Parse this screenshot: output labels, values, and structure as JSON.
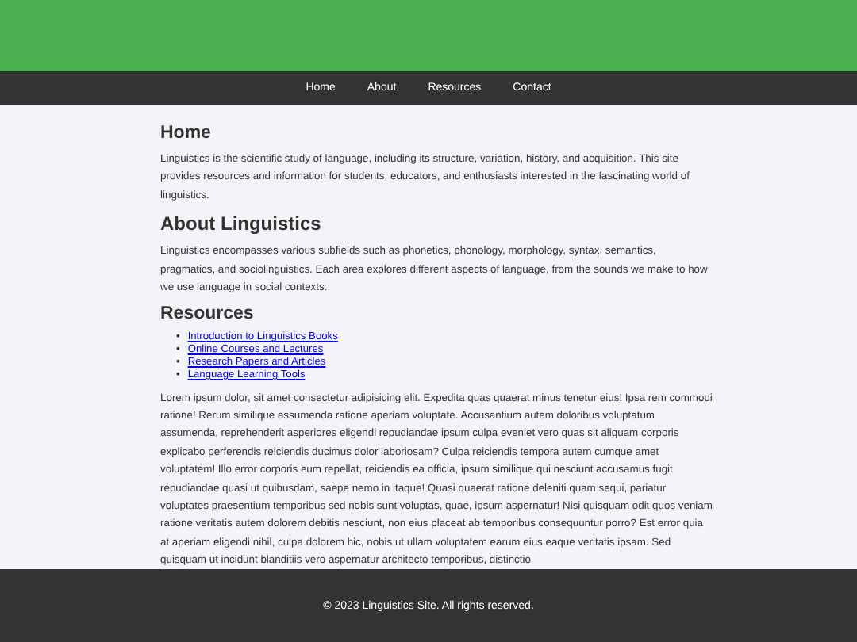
{
  "nav": {
    "items": [
      {
        "label": "Home"
      },
      {
        "label": "About"
      },
      {
        "label": "Resources"
      },
      {
        "label": "Contact"
      }
    ]
  },
  "sections": [
    {
      "heading": "Home",
      "paragraph": "Linguistics is the scientific study of language, including its structure, variation, history, and acquisition. This site provides resources and information for students, educators, and enthusiasts interested in the fascinating world of linguistics."
    },
    {
      "heading": "About Linguistics",
      "paragraph": "Linguistics encompasses various subfields such as phonetics, phonology, morphology, syntax, semantics, pragmatics, and sociolinguistics. Each area explores different aspects of language, from the sounds we make to how we use language in social contexts."
    },
    {
      "heading": "Resources",
      "links": [
        {
          "bullet": "•",
          "label": "Introduction to Linguistics Books"
        },
        {
          "bullet": "•",
          "label": "Online Courses and Lectures"
        },
        {
          "bullet": "•",
          "label": "Research Papers and Articles"
        },
        {
          "bullet": "•",
          "label": "Language Learning Tools"
        }
      ],
      "paragraph": "Lorem ipsum dolor, sit amet consectetur adipisicing elit. Expedita quas quaerat minus tenetur eius! Ipsa rem commodi ratione! Rerum similique assumenda ratione aperiam voluptate. Accusantium autem doloribus voluptatum assumenda, reprehenderit asperiores eligendi repudiandae ipsum culpa eveniet vero quas sit aliquam corporis explicabo perferendis reiciendis ducimus dolor laboriosam? Culpa reiciendis tempora autem cumque amet voluptatem! Illo error corporis eum repellat, reiciendis ea officia, ipsum similique qui nesciunt accusamus fugit repudiandae quasi ut quibusdam, saepe nemo in itaque! Quasi quaerat ratione deleniti quam sequi, pariatur voluptates praesentium temporibus sed nobis sunt voluptas, quae, ipsum aspernatur! Nisi quisquam odit quos veniam ratione veritatis autem dolorem debitis nesciunt, non eius placeat ab temporibus consequuntur porro? Est error quia at aperiam eligendi nihil, culpa dolorem hic, nobis ut ullam voluptatem earum eius eaque veritatis ipsam. Sed quisquam ut incidunt blanditiis vero aspernatur architecto temporibus, distinctio"
    }
  ],
  "footer": {
    "text": "© 2023 Linguistics Site. All rights reserved."
  }
}
